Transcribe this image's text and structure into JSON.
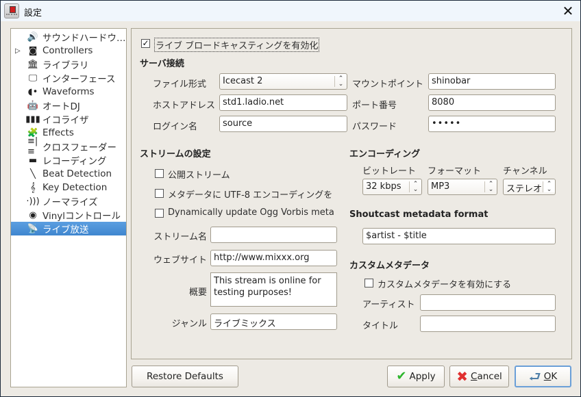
{
  "window": {
    "title": "設定",
    "close_icon": "close-icon"
  },
  "sidebar": {
    "items": [
      {
        "label": "サウンドハードウ…",
        "icon": "speaker-icon",
        "glyph": "🔊",
        "expandable": false,
        "selected": false
      },
      {
        "label": "Controllers",
        "icon": "controller-icon",
        "glyph": "◙",
        "expandable": true,
        "selected": false
      },
      {
        "label": "ライブラリ",
        "icon": "library-icon",
        "glyph": "🏛",
        "expandable": false,
        "selected": false
      },
      {
        "label": "インターフェース",
        "icon": "monitor-icon",
        "glyph": "🖵",
        "expandable": false,
        "selected": false
      },
      {
        "label": "Waveforms",
        "icon": "waveform-icon",
        "glyph": "◖•",
        "expandable": false,
        "selected": false
      },
      {
        "label": "オートDJ",
        "icon": "robot-icon",
        "glyph": "🤖",
        "expandable": false,
        "selected": false
      },
      {
        "label": "イコライザ",
        "icon": "equalizer-icon",
        "glyph": "▮▮▮",
        "expandable": false,
        "selected": false
      },
      {
        "label": "Effects",
        "icon": "puzzle-icon",
        "glyph": "🧩",
        "expandable": false,
        "selected": false
      },
      {
        "label": "クロスフェーダー",
        "icon": "crossfader-icon",
        "glyph": "≡|≡",
        "expandable": false,
        "selected": false
      },
      {
        "label": "レコーディング",
        "icon": "recording-icon",
        "glyph": "▬",
        "expandable": false,
        "selected": false
      },
      {
        "label": "Beat Detection",
        "icon": "metronome-icon",
        "glyph": "╲",
        "expandable": false,
        "selected": false
      },
      {
        "label": "Key Detection",
        "icon": "music-key-icon",
        "glyph": "𝄞",
        "expandable": false,
        "selected": false
      },
      {
        "label": "ノーマライズ",
        "icon": "normalize-icon",
        "glyph": "·)))",
        "expandable": false,
        "selected": false
      },
      {
        "label": "Vinylコントロール",
        "icon": "vinyl-icon",
        "glyph": "◉",
        "expandable": false,
        "selected": false
      },
      {
        "label": "ライブ放送",
        "icon": "satellite-dish-icon",
        "glyph": "📡",
        "expandable": false,
        "selected": true
      }
    ],
    "expand_glyph": "▷"
  },
  "main": {
    "enable_live": {
      "label": "ライブ ブロードキャスティングを有効化",
      "checked": true
    },
    "server": {
      "title": "サーバ接続",
      "type_label": "ファイル形式",
      "type_value": "Icecast 2",
      "host_label": "ホストアドレス",
      "host_value": "std1.ladio.net",
      "login_label": "ログイン名",
      "login_value": "source",
      "mount_label": "マウントポイント",
      "mount_value": "shinobar",
      "port_label": "ポート番号",
      "port_value": "8080",
      "password_label": "パスワード",
      "password_value": "•••••"
    },
    "stream": {
      "title": "ストリームの設定",
      "public_label": "公開ストリーム",
      "public_checked": false,
      "utf8_label": "メタデータに UTF-8 エンコーディングを",
      "utf8_checked": false,
      "ogg_label": "Dynamically update Ogg Vorbis meta",
      "ogg_checked": false,
      "name_label": "ストリーム名",
      "name_value": "",
      "website_label": "ウェブサイト",
      "website_value": "http://www.mixxx.org",
      "desc_label": "概要",
      "desc_value": "This stream is online for testing purposes!",
      "genre_label": "ジャンル",
      "genre_value": "ライブミックス"
    },
    "encoding": {
      "title": "エンコーディング",
      "bitrate_label": "ビットレート",
      "bitrate_value": "32 kbps",
      "format_label": "フォーマット",
      "format_value": "MP3",
      "channels_label": "チャンネル",
      "channels_value": "ステレオ"
    },
    "shoutcast": {
      "title": "Shoutcast metadata format",
      "value": "$artist - $title"
    },
    "custom": {
      "title": "カスタムメタデータ",
      "enable_label": "カスタムメタデータを有効にする",
      "enable_checked": false,
      "artist_label": "アーティスト",
      "artist_value": "",
      "title_label": "タイトル",
      "title_value": ""
    }
  },
  "buttons": {
    "restore": "Restore Defaults",
    "apply": "Apply",
    "cancel_mnemonic": "C",
    "cancel_rest": "ancel",
    "ok_mnemonic": "O",
    "ok_rest": "K"
  },
  "colors": {
    "selection": "#4a90d9",
    "apply_check": "#2db52d",
    "cancel_x": "#e03030",
    "ok_arrow": "#4f7fa8"
  }
}
